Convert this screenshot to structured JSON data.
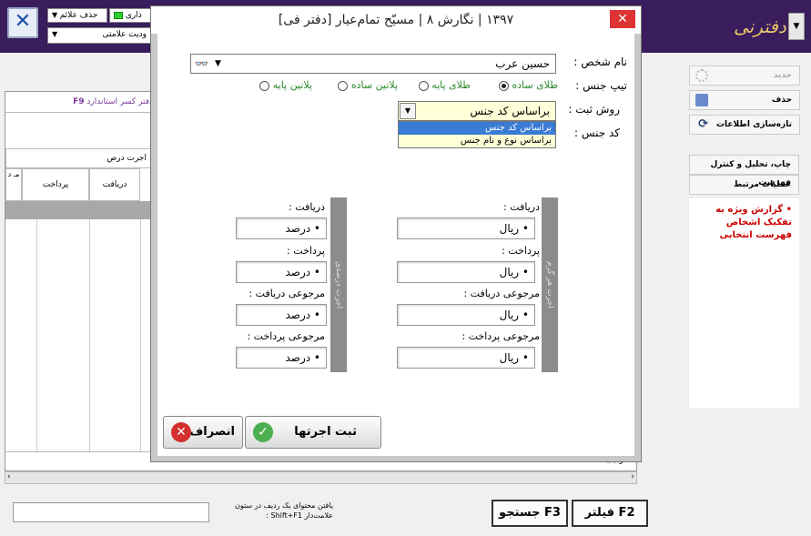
{
  "toolbar": {
    "delete_marks": "حذف علائم",
    "group_label": "ذاری",
    "marks_status": "ودیت علامتی",
    "close_glyph": "✕"
  },
  "app": {
    "logo": "دفترنی",
    "menu_glyph": "▼"
  },
  "grid": {
    "tab_label": "دفتر کسر استاندارد",
    "tab_key": "F9",
    "wage_header": "اجرت درص",
    "col_receive": "دریافت",
    "col_pay": "پرداخت",
    "col_extra": "مـ د",
    "row_label": "• ردیف"
  },
  "side": {
    "new": "جدید",
    "delete": "حذف",
    "refresh": "تازه‌سازی اطلاعات",
    "print": "چاپ، تحلیل و کنترل فهرست",
    "related": "عملیات مرتبط",
    "report": "• گزارش ویژه به تفکیک اشخاص فهرست انتخابی"
  },
  "status": {
    "note": "یافتن محتوای یک ردیف در ستون علامت‌دار Shift+F1 :"
  },
  "fbuttons": {
    "search": "جستجو F3",
    "filter": "فیلتر F2"
  },
  "dialog": {
    "title": "[دفتر فی] ۱۳۹۷ | نگارش ۸ | مسیّح تمام‌عیار",
    "close": "✕",
    "person_label": "نام شخص :",
    "person_value": "حسین عرب",
    "type_label": "تیپ جنس :",
    "types": [
      "طلای ساده",
      "طلای پایه",
      "پلاتین ساده",
      "پلاتین پایه"
    ],
    "method_label": "روش ثبت :",
    "method_value": "براساس کد جنس",
    "method_options": [
      "براساس کد جنس",
      "براساس نوع و نام جنس"
    ],
    "code_label": "کد جنس :",
    "left_group": "اجرت درصدی",
    "right_group": "اجرت هر گرم",
    "fields": [
      "دریافت :",
      "پرداخت :",
      "مرجوعی دریافت :",
      "مرجوعی پرداخت :"
    ],
    "left_unit": "• درصد",
    "right_unit": "• ریال",
    "save": "ثبت اجرتها",
    "cancel": "انصراف"
  }
}
